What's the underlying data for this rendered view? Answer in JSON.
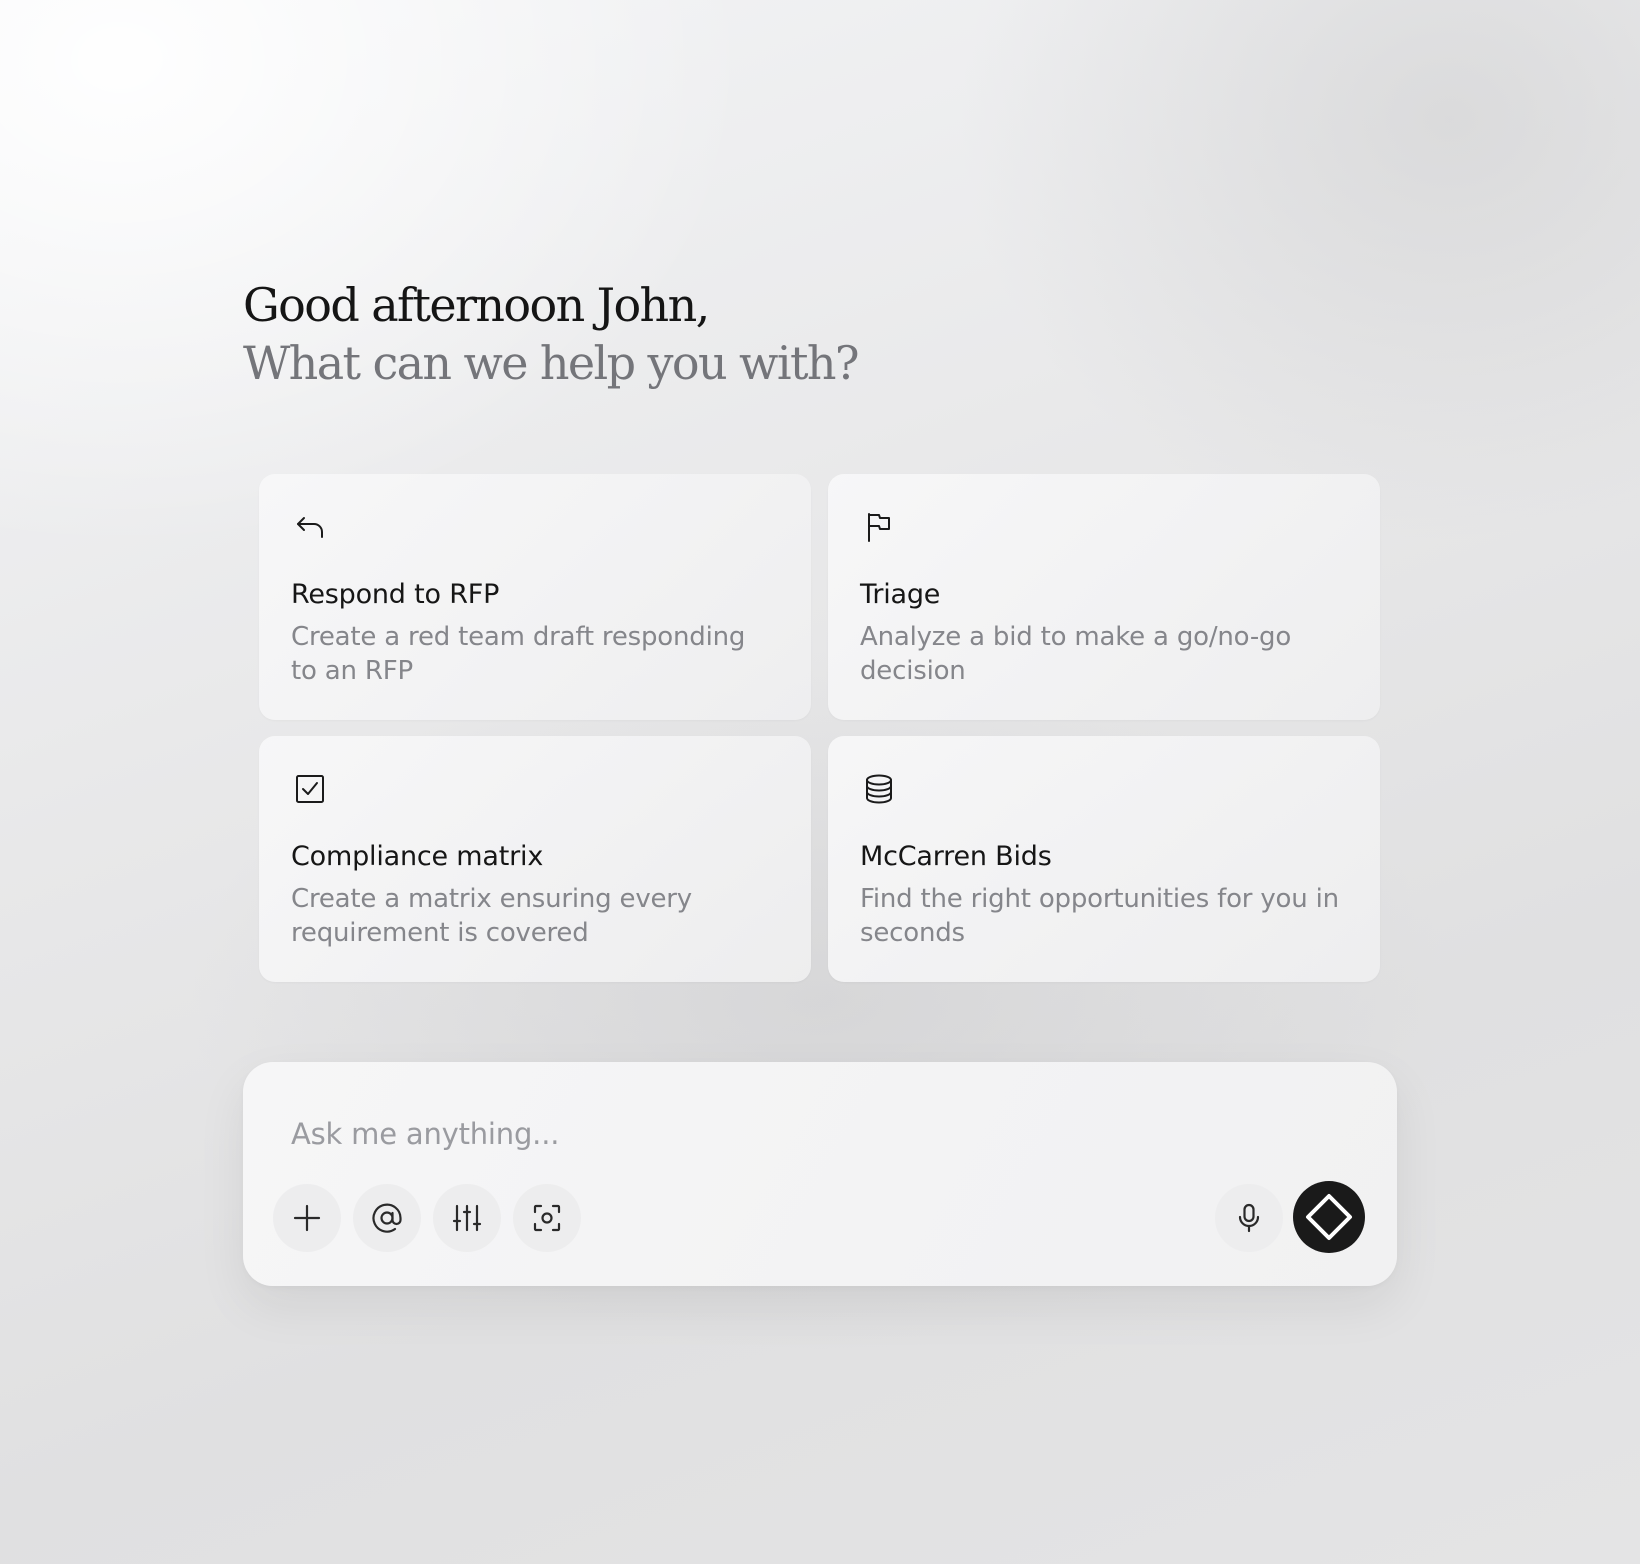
{
  "greeting": {
    "line1": "Good afternoon John,",
    "line2": "What can we help you with?"
  },
  "cards": [
    {
      "icon": "reply-arrow-icon",
      "title": "Respond to RFP",
      "description": "Create a red team draft responding to an RFP"
    },
    {
      "icon": "flag-icon",
      "title": "Triage",
      "description": "Analyze a bid to make a go/no-go decision"
    },
    {
      "icon": "checkbox-icon",
      "title": "Compliance matrix",
      "description": "Create a matrix ensuring every requirement is covered"
    },
    {
      "icon": "database-icon",
      "title": "McCarren Bids",
      "description": "Find the right opportunities for you in seconds"
    }
  ],
  "composer": {
    "placeholder": "Ask me anything...",
    "value": "",
    "tools": [
      "plus-icon",
      "at-sign-icon",
      "sliders-icon",
      "scan-icon"
    ],
    "mic_icon": "microphone-icon",
    "send_icon": "diamond-logo-icon"
  },
  "colors": {
    "heading": "#151515",
    "subheading": "#74757a",
    "card_desc": "#85868b",
    "send_button": "#1a1a1a"
  }
}
